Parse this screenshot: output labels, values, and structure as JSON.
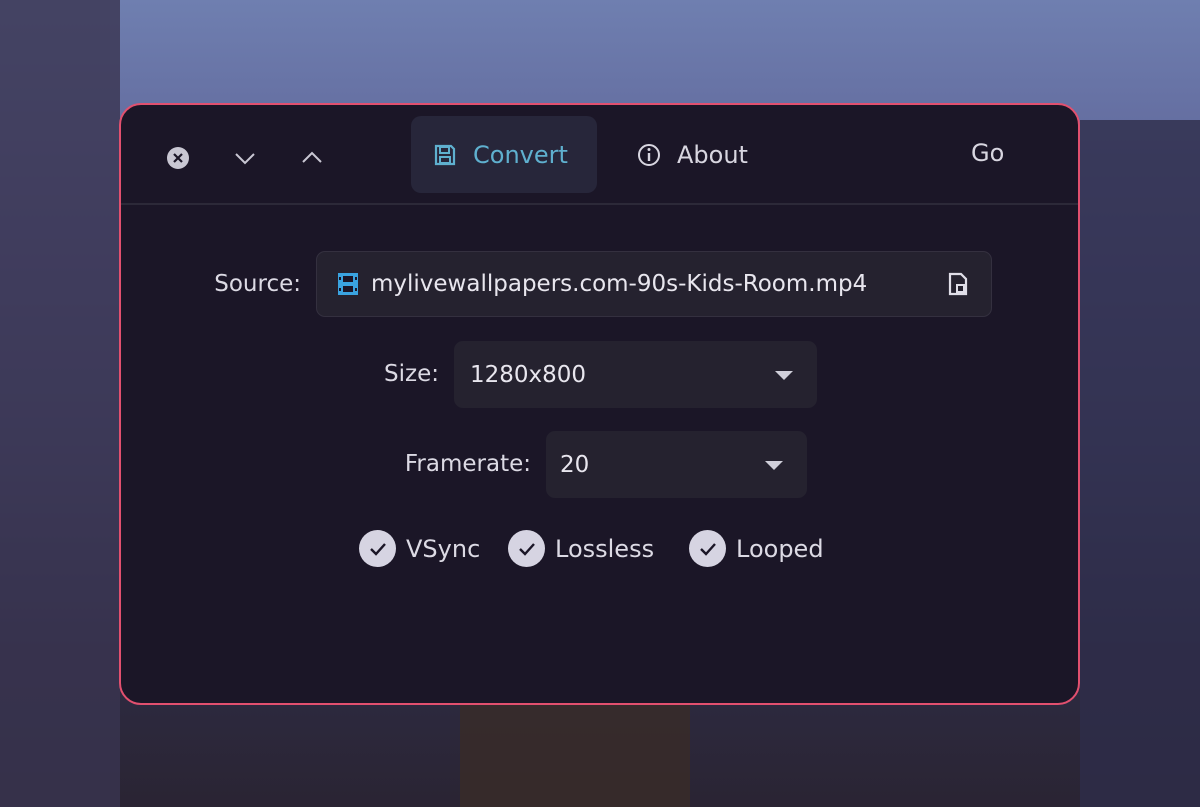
{
  "header": {
    "window_controls": [
      "close-icon",
      "chevron-down-icon",
      "chevron-up-icon"
    ],
    "tabs": [
      {
        "label": "Convert",
        "icon": "floppy-disk-icon",
        "active": true
      },
      {
        "label": "About",
        "icon": "info-icon",
        "active": false
      }
    ],
    "go_label": "Go"
  },
  "form": {
    "source": {
      "label": "Source:",
      "value": "mylivewallpapers.com-90s-Kids-Room.mp4",
      "icon": "film-icon",
      "action_icon": "file-open-icon"
    },
    "size": {
      "label": "Size:",
      "value": "1280x800"
    },
    "framerate": {
      "label": "Framerate:",
      "value": "20"
    },
    "options": [
      {
        "label": "VSync",
        "checked": true
      },
      {
        "label": "Lossless",
        "checked": true
      },
      {
        "label": "Looped",
        "checked": true
      }
    ]
  },
  "colors": {
    "accent": "#5fb0cf",
    "border": "#e2506f",
    "window_bg": "#1b1627"
  }
}
